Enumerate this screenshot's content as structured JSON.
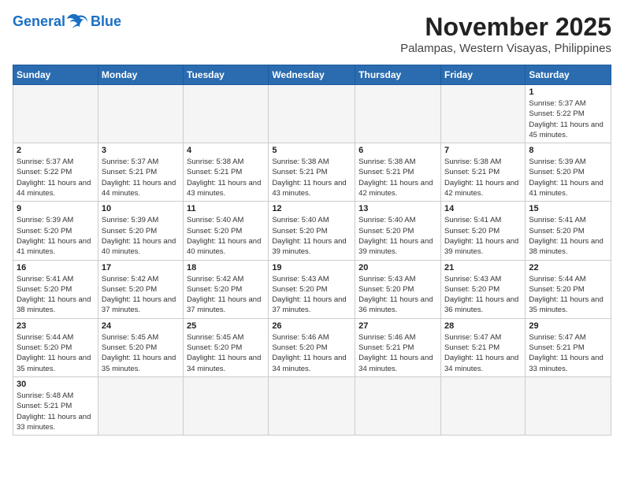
{
  "header": {
    "logo_general": "General",
    "logo_blue": "Blue",
    "month_title": "November 2025",
    "location": "Palampas, Western Visayas, Philippines"
  },
  "days_of_week": [
    "Sunday",
    "Monday",
    "Tuesday",
    "Wednesday",
    "Thursday",
    "Friday",
    "Saturday"
  ],
  "weeks": [
    [
      {
        "day": "",
        "info": ""
      },
      {
        "day": "",
        "info": ""
      },
      {
        "day": "",
        "info": ""
      },
      {
        "day": "",
        "info": ""
      },
      {
        "day": "",
        "info": ""
      },
      {
        "day": "",
        "info": ""
      },
      {
        "day": "1",
        "info": "Sunrise: 5:37 AM\nSunset: 5:22 PM\nDaylight: 11 hours and 45 minutes."
      }
    ],
    [
      {
        "day": "2",
        "info": "Sunrise: 5:37 AM\nSunset: 5:22 PM\nDaylight: 11 hours and 44 minutes."
      },
      {
        "day": "3",
        "info": "Sunrise: 5:37 AM\nSunset: 5:21 PM\nDaylight: 11 hours and 44 minutes."
      },
      {
        "day": "4",
        "info": "Sunrise: 5:38 AM\nSunset: 5:21 PM\nDaylight: 11 hours and 43 minutes."
      },
      {
        "day": "5",
        "info": "Sunrise: 5:38 AM\nSunset: 5:21 PM\nDaylight: 11 hours and 43 minutes."
      },
      {
        "day": "6",
        "info": "Sunrise: 5:38 AM\nSunset: 5:21 PM\nDaylight: 11 hours and 42 minutes."
      },
      {
        "day": "7",
        "info": "Sunrise: 5:38 AM\nSunset: 5:21 PM\nDaylight: 11 hours and 42 minutes."
      },
      {
        "day": "8",
        "info": "Sunrise: 5:39 AM\nSunset: 5:20 PM\nDaylight: 11 hours and 41 minutes."
      }
    ],
    [
      {
        "day": "9",
        "info": "Sunrise: 5:39 AM\nSunset: 5:20 PM\nDaylight: 11 hours and 41 minutes."
      },
      {
        "day": "10",
        "info": "Sunrise: 5:39 AM\nSunset: 5:20 PM\nDaylight: 11 hours and 40 minutes."
      },
      {
        "day": "11",
        "info": "Sunrise: 5:40 AM\nSunset: 5:20 PM\nDaylight: 11 hours and 40 minutes."
      },
      {
        "day": "12",
        "info": "Sunrise: 5:40 AM\nSunset: 5:20 PM\nDaylight: 11 hours and 39 minutes."
      },
      {
        "day": "13",
        "info": "Sunrise: 5:40 AM\nSunset: 5:20 PM\nDaylight: 11 hours and 39 minutes."
      },
      {
        "day": "14",
        "info": "Sunrise: 5:41 AM\nSunset: 5:20 PM\nDaylight: 11 hours and 39 minutes."
      },
      {
        "day": "15",
        "info": "Sunrise: 5:41 AM\nSunset: 5:20 PM\nDaylight: 11 hours and 38 minutes."
      }
    ],
    [
      {
        "day": "16",
        "info": "Sunrise: 5:41 AM\nSunset: 5:20 PM\nDaylight: 11 hours and 38 minutes."
      },
      {
        "day": "17",
        "info": "Sunrise: 5:42 AM\nSunset: 5:20 PM\nDaylight: 11 hours and 37 minutes."
      },
      {
        "day": "18",
        "info": "Sunrise: 5:42 AM\nSunset: 5:20 PM\nDaylight: 11 hours and 37 minutes."
      },
      {
        "day": "19",
        "info": "Sunrise: 5:43 AM\nSunset: 5:20 PM\nDaylight: 11 hours and 37 minutes."
      },
      {
        "day": "20",
        "info": "Sunrise: 5:43 AM\nSunset: 5:20 PM\nDaylight: 11 hours and 36 minutes."
      },
      {
        "day": "21",
        "info": "Sunrise: 5:43 AM\nSunset: 5:20 PM\nDaylight: 11 hours and 36 minutes."
      },
      {
        "day": "22",
        "info": "Sunrise: 5:44 AM\nSunset: 5:20 PM\nDaylight: 11 hours and 35 minutes."
      }
    ],
    [
      {
        "day": "23",
        "info": "Sunrise: 5:44 AM\nSunset: 5:20 PM\nDaylight: 11 hours and 35 minutes."
      },
      {
        "day": "24",
        "info": "Sunrise: 5:45 AM\nSunset: 5:20 PM\nDaylight: 11 hours and 35 minutes."
      },
      {
        "day": "25",
        "info": "Sunrise: 5:45 AM\nSunset: 5:20 PM\nDaylight: 11 hours and 34 minutes."
      },
      {
        "day": "26",
        "info": "Sunrise: 5:46 AM\nSunset: 5:20 PM\nDaylight: 11 hours and 34 minutes."
      },
      {
        "day": "27",
        "info": "Sunrise: 5:46 AM\nSunset: 5:21 PM\nDaylight: 11 hours and 34 minutes."
      },
      {
        "day": "28",
        "info": "Sunrise: 5:47 AM\nSunset: 5:21 PM\nDaylight: 11 hours and 34 minutes."
      },
      {
        "day": "29",
        "info": "Sunrise: 5:47 AM\nSunset: 5:21 PM\nDaylight: 11 hours and 33 minutes."
      }
    ],
    [
      {
        "day": "30",
        "info": "Sunrise: 5:48 AM\nSunset: 5:21 PM\nDaylight: 11 hours and 33 minutes."
      },
      {
        "day": "",
        "info": ""
      },
      {
        "day": "",
        "info": ""
      },
      {
        "day": "",
        "info": ""
      },
      {
        "day": "",
        "info": ""
      },
      {
        "day": "",
        "info": ""
      },
      {
        "day": "",
        "info": ""
      }
    ]
  ]
}
